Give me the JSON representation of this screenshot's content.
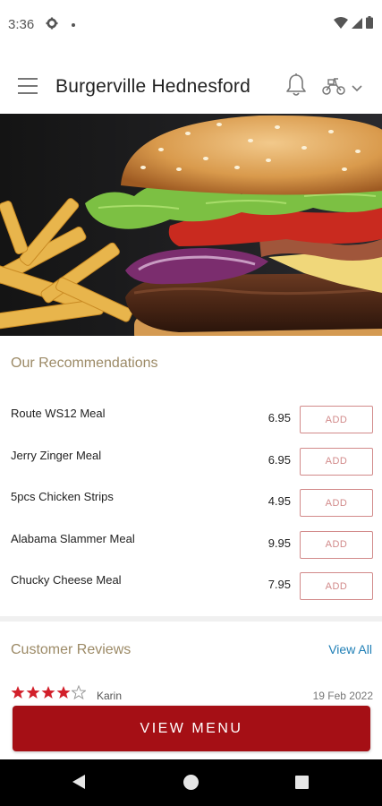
{
  "status_bar": {
    "time": "3:36",
    "icons": [
      "gear-icon",
      "dot-icon",
      "wifi-icon",
      "signal-icon",
      "battery-icon"
    ]
  },
  "header": {
    "title": "Burgerville Hednesford",
    "icons": [
      "menu-icon",
      "bell-icon",
      "scooter-icon",
      "chevron-down-icon"
    ]
  },
  "hero": {
    "image": "burger-and-fries-photo"
  },
  "recommendations": {
    "title": "Our Recommendations",
    "add_label": "ADD",
    "items": [
      {
        "name": "Route WS12 Meal",
        "price": "6.95"
      },
      {
        "name": "Jerry Zinger Meal",
        "price": "6.95"
      },
      {
        "name": "5pcs Chicken Strips",
        "price": "4.95"
      },
      {
        "name": "Alabama Slammer Meal",
        "price": "9.95"
      },
      {
        "name": "Chucky Cheese Meal",
        "price": "7.95"
      }
    ]
  },
  "reviews": {
    "title": "Customer Reviews",
    "view_all": "View All",
    "first": {
      "stars": 4,
      "out_of": 5,
      "name": "Karin",
      "date": "19 Feb 2022"
    }
  },
  "cta": {
    "label": "VIEW MENU"
  },
  "colors": {
    "brand_red": "#a50f15",
    "section_title": "#9c8a66",
    "add_outline": "#d28a8a",
    "link_blue": "#1f7fb6",
    "star_red": "#d21f2a"
  }
}
